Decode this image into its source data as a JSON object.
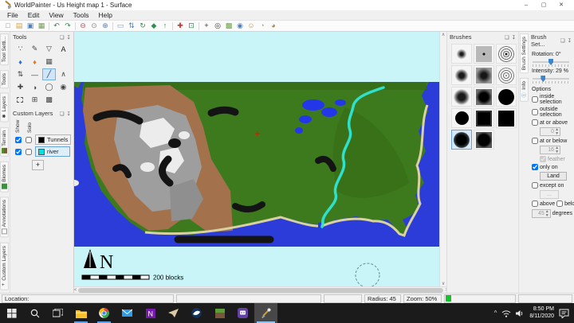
{
  "window": {
    "title": "WorldPainter - Us Height map 1 - Surface",
    "minimize": "–",
    "maximize": "▢",
    "close": "✕"
  },
  "menu": {
    "items": [
      "File",
      "Edit",
      "View",
      "Tools",
      "Help"
    ]
  },
  "panel_chrome": {
    "float_icon": "❏",
    "pin_icon": "↧"
  },
  "toolbar": {
    "icons": [
      {
        "name": "new-world",
        "glyph": "□",
        "color": "#8a8a8a"
      },
      {
        "name": "open-world",
        "glyph": "▤",
        "color": "#d9a33c"
      },
      {
        "name": "save-world",
        "glyph": "▣",
        "color": "#4a7fc1"
      },
      {
        "name": "export-image",
        "glyph": "▦",
        "color": "#6fa14e"
      },
      {
        "name": "undo",
        "glyph": "↶",
        "color": "#2f8f4e"
      },
      {
        "name": "redo",
        "glyph": "↷",
        "color": "#2f8f4e"
      },
      {
        "name": "zoom-out",
        "glyph": "⊖",
        "color": "#b05a5a"
      },
      {
        "name": "reset-zoom",
        "glyph": "⊙",
        "color": "#8a8a8a"
      },
      {
        "name": "zoom-in",
        "glyph": "⊕",
        "color": "#5a7fb0"
      },
      {
        "name": "fit-view",
        "glyph": "▭",
        "color": "#7a9ac0"
      },
      {
        "name": "flip",
        "glyph": "⇅",
        "color": "#4a7fc1"
      },
      {
        "name": "rotate",
        "glyph": "↻",
        "color": "#2f8f4e"
      },
      {
        "name": "three-d-view",
        "glyph": "◆",
        "color": "#2f8f4e"
      },
      {
        "name": "raise",
        "glyph": "↑",
        "color": "#2f8f4e"
      },
      {
        "name": "move-origin",
        "glyph": "✚",
        "color": "#c0392b"
      },
      {
        "name": "expand-world",
        "glyph": "⊡",
        "color": "#2f8f4e"
      },
      {
        "name": "grid",
        "glyph": "+",
        "color": "#333333"
      },
      {
        "name": "spawn",
        "glyph": "◎",
        "color": "#333333"
      },
      {
        "name": "overlay",
        "glyph": "▩",
        "color": "#6fa14e"
      },
      {
        "name": "view-distance",
        "glyph": "◉",
        "color": "#4a7fc1"
      },
      {
        "name": "walking-distance",
        "glyph": "☺",
        "color": "#c78f3c"
      },
      {
        "name": "biomes-a",
        "glyph": "◔",
        "color": "#b5a53c"
      },
      {
        "name": "biomes-b",
        "glyph": "◕",
        "color": "#a5853c"
      }
    ]
  },
  "left_tabs": {
    "items": [
      {
        "label": "Tool Setti...",
        "icon": "▤"
      },
      {
        "label": "Tools",
        "icon": "▣"
      },
      {
        "label": "Layers",
        "icon": "✱"
      },
      {
        "label": "Terrain",
        "icon": ""
      },
      {
        "label": "Biomes",
        "icon": ""
      },
      {
        "label": "Annotations",
        "icon": ""
      },
      {
        "label": "Custom Layers",
        "icon": "+"
      }
    ]
  },
  "tools_panel": {
    "title": "Tools",
    "tools": [
      {
        "name": "spray-paint",
        "glyph": "∵",
        "color": "#444444"
      },
      {
        "name": "pencil",
        "glyph": "✎",
        "color": "#444444"
      },
      {
        "name": "flood-fill",
        "glyph": "▽",
        "color": "#444444"
      },
      {
        "name": "text",
        "glyph": "A",
        "color": "#222222"
      },
      {
        "name": "flood-water",
        "glyph": "♦",
        "color": "#2a6fd4"
      },
      {
        "name": "flood-lava",
        "glyph": "♦",
        "color": "#e07820"
      },
      {
        "name": "sponge",
        "glyph": "▦",
        "color": "#555555"
      },
      {
        "name": "raise-lower",
        "glyph": "⇅",
        "color": "#444444"
      },
      {
        "name": "flatten",
        "glyph": "—",
        "color": "#444444"
      },
      {
        "name": "line",
        "glyph": "╱",
        "color": "#334466"
      },
      {
        "name": "raise-mountain",
        "glyph": "∧",
        "color": "#444444"
      },
      {
        "name": "move-player",
        "glyph": "✚",
        "color": "#444444"
      },
      {
        "name": "globe",
        "glyph": "◑",
        "color": "#444444"
      },
      {
        "name": "smooth",
        "glyph": "◯",
        "color": "#444444"
      },
      {
        "name": "view",
        "glyph": "◉",
        "color": "#444444"
      },
      {
        "name": "marquee-select",
        "glyph": "",
        "color": "#444444"
      },
      {
        "name": "copy-selection",
        "glyph": "⊞",
        "color": "#444444"
      },
      {
        "name": "global-operations",
        "glyph": "▩",
        "color": "#444444"
      }
    ]
  },
  "custom_layers_panel": {
    "title": "Custom Layers",
    "show_label": "Show",
    "solo_label": "Solo",
    "add_label": "+",
    "layers": [
      {
        "label": "Tunnels",
        "color": "#000000",
        "show": true,
        "solo": false
      },
      {
        "label": "river",
        "color": "#00e2e2",
        "show": true,
        "solo": false
      }
    ]
  },
  "map": {
    "compass_label": "N",
    "scale_label": "200 blocks",
    "colors": {
      "background": "#c9f5f8",
      "ocean": "#2b3cd8",
      "land_green": "#3d7a1d",
      "mountain_brown": "#a3714b",
      "mountain_gray": "#9e9e9e",
      "snow_white": "#ececec",
      "beach_tan": "#d9d2a0",
      "river_cyan": "#2fe0cb",
      "lake_blue": "#2337e8",
      "tunnel_black": "#141414",
      "marker_red": "#cc2200"
    }
  },
  "brushes_panel": {
    "title": "Brushes",
    "brushes": [
      "soft-circle-small",
      "square-center-dot",
      "spray-circle-small",
      "soft-circle-medium",
      "square-soft",
      "spray-circle-large",
      "soft-circle-large",
      "square-soft-dark",
      "solid-circle-large",
      "solid-circle",
      "solid-square-outlined",
      "solid-square",
      "soft-circle-selected",
      "square-soft-darkest"
    ],
    "selected": "soft-circle-selected"
  },
  "right_tabs": {
    "items": [
      {
        "label": "Brush Settings",
        "icon": ""
      },
      {
        "label": "Info",
        "icon": "ⓘ"
      }
    ]
  },
  "brush_settings": {
    "title": "Brush Set...",
    "rotation_label": "Rotation: 0°",
    "rotation_percent": 50,
    "intensity_label": "Intensity: 29 %",
    "intensity_percent": 29,
    "options_label": "Options",
    "inside_selection": {
      "label": "inside selection",
      "checked": false
    },
    "outside_selection": {
      "label": "outside selection",
      "checked": false
    },
    "at_or_above": {
      "label": "at or above",
      "checked": false,
      "value": "0"
    },
    "at_or_below": {
      "label": "at or below",
      "checked": false,
      "value": "16"
    },
    "feather": {
      "label": "feather",
      "checked": true
    },
    "only_on": {
      "label": "only on",
      "checked": true,
      "button_label": "Land"
    },
    "except_on": {
      "label": "except on",
      "checked": false,
      "button_label": "..."
    },
    "above": {
      "label": "above",
      "checked": false
    },
    "below": {
      "label": "below",
      "checked": false
    },
    "degrees": {
      "value": "45",
      "label": "degrees"
    }
  },
  "status_bar": {
    "location_label": "Location:",
    "radius_label": "Radius: 45",
    "zoom_label": "Zoom: 50%"
  },
  "taskbar": {
    "tray": {
      "chevron": "^",
      "time": "8:50 PM",
      "date": "8/11/2020"
    }
  }
}
